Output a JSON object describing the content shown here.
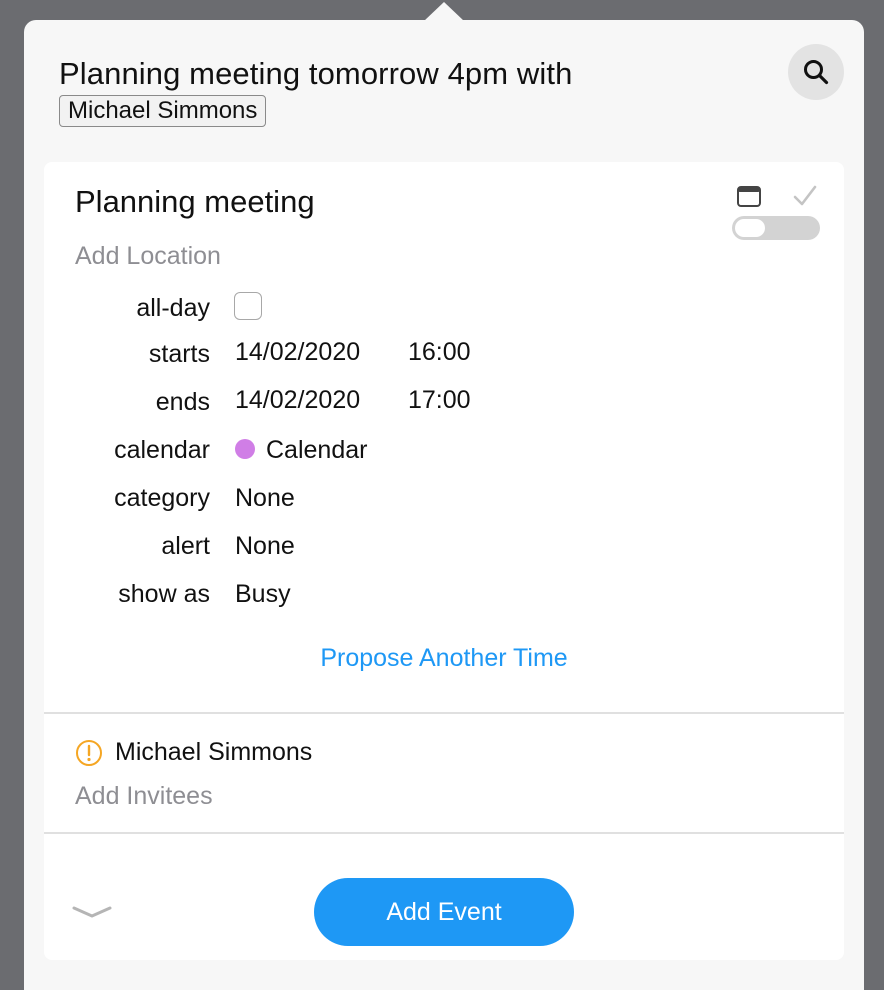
{
  "query": {
    "text": "Planning meeting tomorrow 4pm with",
    "token": "Michael Simmons"
  },
  "icons": {
    "search": "search-icon",
    "calendar": "calendar-icon",
    "check": "checkmark-icon",
    "warning": "warning-circle-icon",
    "collapse": "chevron-down-icon"
  },
  "event": {
    "title": "Planning meeting",
    "location_placeholder": "Add Location",
    "fields": {
      "all_day": {
        "label": "all-day",
        "checked": false
      },
      "starts": {
        "label": "starts",
        "date": "14/02/2020",
        "time": "16:00"
      },
      "ends": {
        "label": "ends",
        "date": "14/02/2020",
        "time": "17:00"
      },
      "calendar": {
        "label": "calendar",
        "value": "Calendar",
        "color": "#d07ee6"
      },
      "category": {
        "label": "category",
        "value": "None"
      },
      "alert": {
        "label": "alert",
        "value": "None"
      },
      "show_as": {
        "label": "show as",
        "value": "Busy"
      }
    },
    "propose_link": "Propose Another Time"
  },
  "invitees": {
    "items": [
      {
        "name": "Michael Simmons",
        "status_color": "#f5a623"
      }
    ],
    "add_placeholder": "Add Invitees"
  },
  "footer": {
    "add_button": "Add Event"
  },
  "colors": {
    "accent": "#1e98f5",
    "warning": "#f5a623",
    "placeholder": "#8e8e93"
  }
}
